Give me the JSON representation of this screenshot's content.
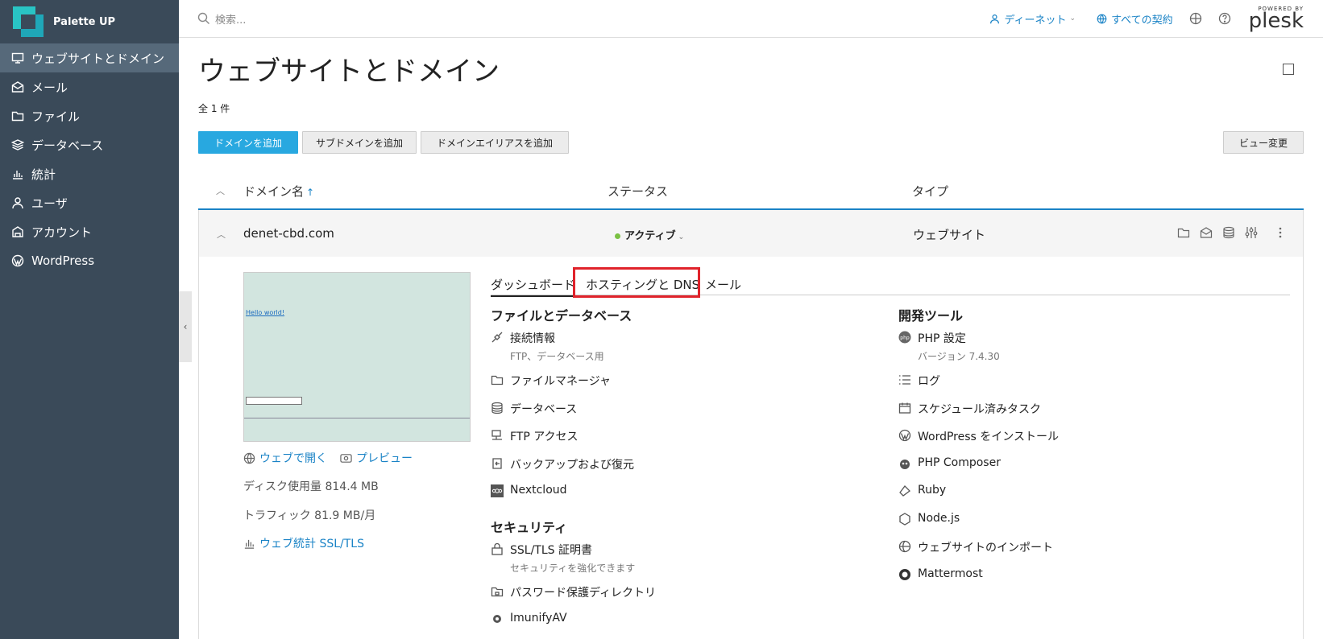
{
  "brand": {
    "name": "Palette UP"
  },
  "sidebar": {
    "items": [
      {
        "label": "ウェブサイトとドメイン",
        "icon": "monitor-icon",
        "active": true
      },
      {
        "label": "メール",
        "icon": "mail-icon"
      },
      {
        "label": "ファイル",
        "icon": "folder-icon"
      },
      {
        "label": "データベース",
        "icon": "database-icon"
      },
      {
        "label": "統計",
        "icon": "stats-icon"
      },
      {
        "label": "ユーザ",
        "icon": "user-icon"
      },
      {
        "label": "アカウント",
        "icon": "account-icon"
      },
      {
        "label": "WordPress",
        "icon": "wordpress-icon"
      }
    ]
  },
  "topbar": {
    "search_placeholder": "検索...",
    "user_label": "ディーネット",
    "subscriptions_label": "すべての契約",
    "powered_by": "POWERED BY",
    "plesk": "plesk"
  },
  "main": {
    "title": "ウェブサイトとドメイン",
    "count": "全 1 件",
    "buttons": {
      "add_domain": "ドメインを追加",
      "add_subdomain": "サブドメインを追加",
      "add_alias": "ドメインエイリアスを追加",
      "change_view": "ビュー変更"
    },
    "columns": {
      "domain": "ドメイン名",
      "sort_arrow": "↑",
      "status": "ステータス",
      "type": "タイプ"
    },
    "row": {
      "domain": "denet-cbd.com",
      "status": "アクティブ",
      "type": "ウェブサイト"
    }
  },
  "detail": {
    "thumb_title": "Hello world!",
    "open_web": "ウェブで開く",
    "preview": "プレビュー",
    "disk_usage": "ディスク使用量 814.4 MB",
    "traffic": "トラフィック 81.9 MB/月",
    "web_stats": "ウェブ統計 SSL/TLS",
    "tabs": [
      "ダッシュボード",
      "ホスティングと DNS",
      "メール"
    ],
    "files_title": "ファイルとデータベース",
    "files": [
      {
        "label": "接続情報",
        "sub": "FTP、データベース用",
        "icon": "connection-icon"
      },
      {
        "label": "ファイルマネージャ",
        "icon": "folder-icon"
      },
      {
        "label": "データベース",
        "icon": "database-icon"
      },
      {
        "label": "FTP アクセス",
        "icon": "ftp-icon"
      },
      {
        "label": "バックアップおよび復元",
        "icon": "backup-icon"
      },
      {
        "label": "Nextcloud",
        "icon": "nextcloud-icon"
      }
    ],
    "security_title": "セキュリティ",
    "security": [
      {
        "label": "SSL/TLS 証明書",
        "sub": "セキュリティを強化できます",
        "icon": "certificate-icon"
      },
      {
        "label": "パスワード保護ディレクトリ",
        "icon": "locked-folder-icon"
      },
      {
        "label": "ImunifyAV",
        "icon": "gear-icon"
      }
    ],
    "dev_title": "開発ツール",
    "dev": [
      {
        "label": "PHP 設定",
        "sub": "バージョン 7.4.30",
        "icon": "php-icon"
      },
      {
        "label": "ログ",
        "icon": "log-icon"
      },
      {
        "label": "スケジュール済みタスク",
        "icon": "calendar-icon"
      },
      {
        "label": "WordPress をインストール",
        "icon": "wordpress-icon"
      },
      {
        "label": "PHP Composer",
        "icon": "composer-icon"
      },
      {
        "label": "Ruby",
        "icon": "ruby-icon"
      },
      {
        "label": "Node.js",
        "icon": "nodejs-icon"
      },
      {
        "label": "ウェブサイトのインポート",
        "icon": "import-icon"
      },
      {
        "label": "Mattermost",
        "icon": "mattermost-icon"
      }
    ]
  }
}
